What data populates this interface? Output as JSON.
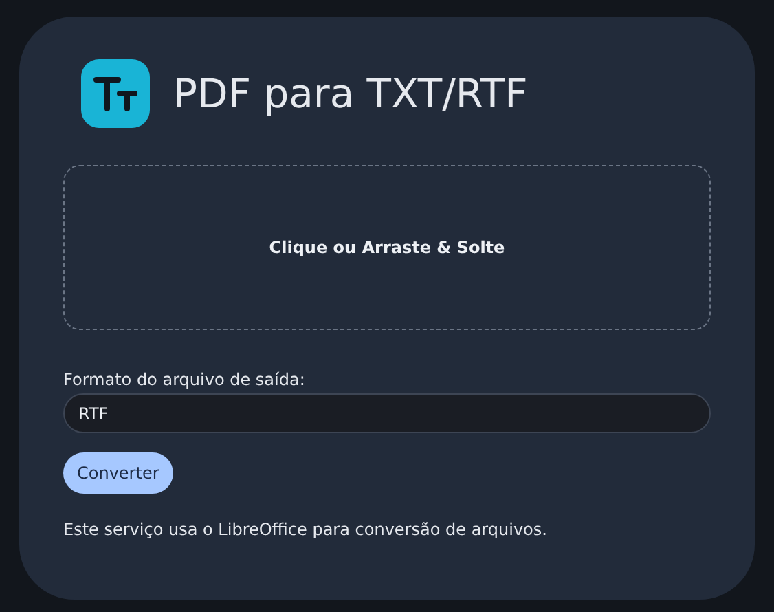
{
  "header": {
    "title": "PDF para TXT/RTF"
  },
  "dropzone": {
    "label": "Clique ou Arraste & Solte"
  },
  "format": {
    "label": "Formato do arquivo de saída:",
    "value": "RTF"
  },
  "buttons": [
    "Converter"
  ],
  "footer": "Este serviço usa o LibreOffice para conversão de arquivos."
}
